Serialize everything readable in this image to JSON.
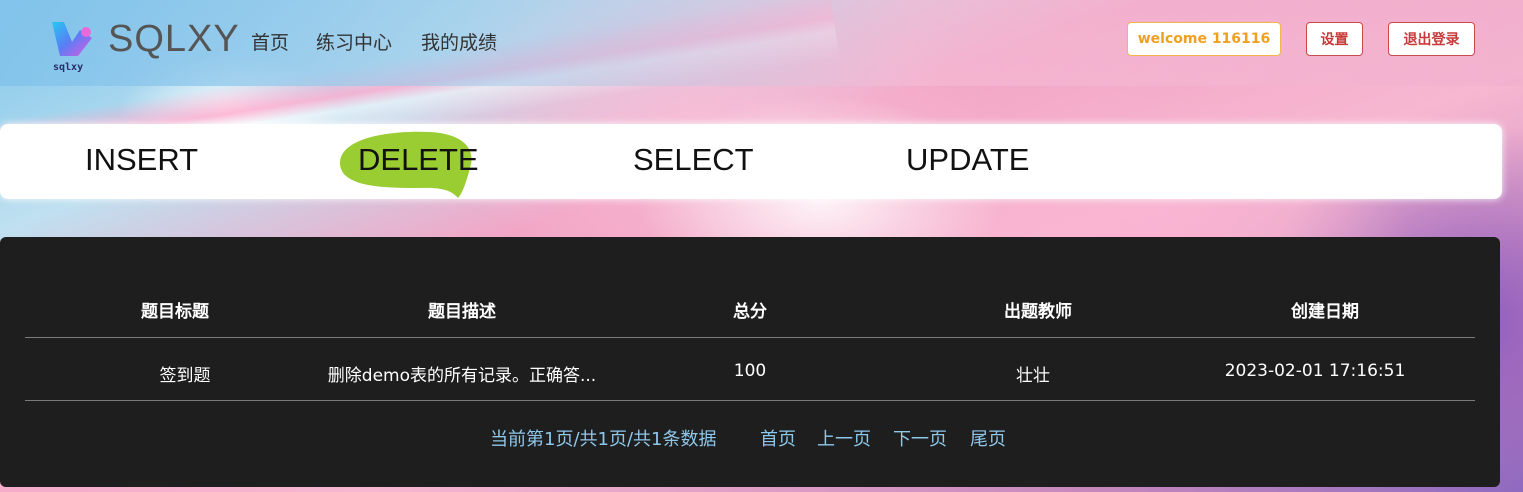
{
  "header": {
    "logo_text": "sqlxy",
    "brand": "SQLXY",
    "nav": [
      {
        "label": "首页"
      },
      {
        "label": "练习中心"
      },
      {
        "label": "我的成绩"
      }
    ],
    "welcome": "welcome 116116",
    "settings": "设置",
    "logout": "退出登录"
  },
  "tabs": {
    "items": [
      "INSERT",
      "DELETE",
      "SELECT",
      "UPDATE"
    ],
    "active": "DELETE",
    "active_color": "#9acd32"
  },
  "table": {
    "headers": [
      "题目标题",
      "题目描述",
      "总分",
      "出题教师",
      "创建日期"
    ],
    "rows": [
      [
        "签到题",
        "删除demo表的所有记录。正确答...",
        "100",
        "壮壮",
        "2023-02-01 17:16:51"
      ]
    ]
  },
  "pagination": {
    "info": "当前第1页/共1页/共1条数据",
    "first": "首页",
    "prev": "上一页",
    "next": "下一页",
    "last": "尾页"
  },
  "colors": {
    "panel_bg": "#1e1e1e",
    "pager_link": "#8ec7ea",
    "welcome_accent": "#f0a020",
    "danger": "#c83a3a"
  }
}
